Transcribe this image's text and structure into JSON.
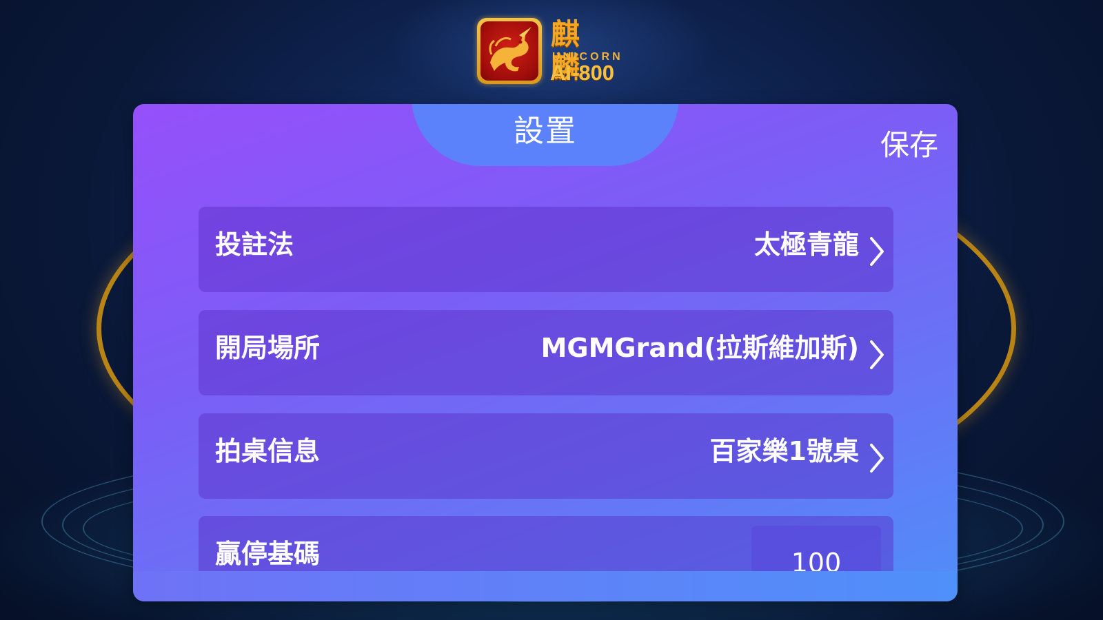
{
  "app": {
    "logo": {
      "name_cn": "麒 麟",
      "name_en": "UNICORN",
      "model": "AI-800"
    }
  },
  "panel": {
    "title": "設置",
    "save_label": "保存",
    "rows": [
      {
        "label": "投註法",
        "value": "太極青龍",
        "icon": "chevron-right-icon"
      },
      {
        "label": "開局場所",
        "value": "MGMGrand(拉斯維加斯)",
        "icon": "chevron-right-icon"
      },
      {
        "label": "拍桌信息",
        "value": "百家樂1號桌",
        "icon": "chevron-right-icon"
      }
    ],
    "win_stop": {
      "label": "贏停基碼",
      "value": "100"
    }
  },
  "colors": {
    "panel_gradient_start": "#9650fb",
    "panel_gradient_end": "#508ef9",
    "title_tab": "#5b82fa",
    "logo_gold": "#f5a623",
    "logo_red": "#c0140e",
    "ring_gold": "#b88416",
    "text": "#ffffff"
  }
}
